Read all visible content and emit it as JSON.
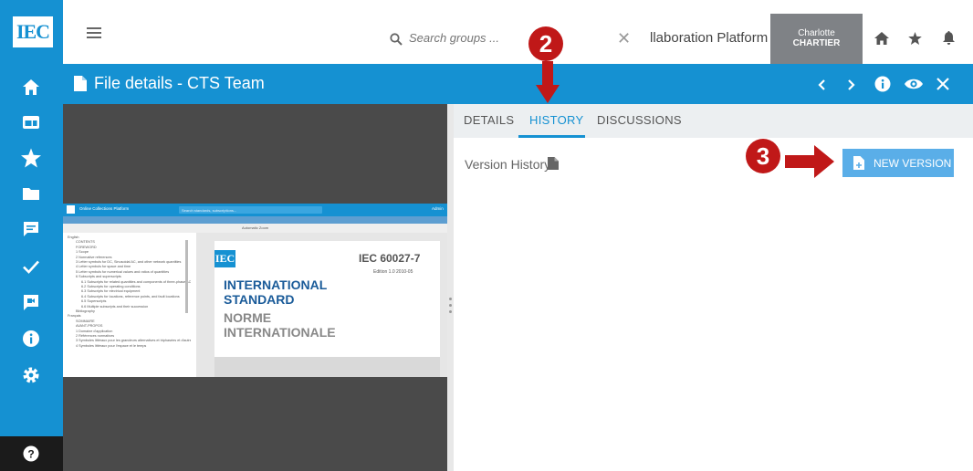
{
  "header": {
    "logo_text": "IEC",
    "search_placeholder": "Search groups ...",
    "platform_title": "llaboration Platform",
    "user": {
      "first_name": "Charlotte",
      "last_name": "CHARTIER"
    },
    "icons": [
      "menu-icon",
      "search-icon",
      "close-icon",
      "home-icon",
      "star-icon",
      "bell-icon"
    ]
  },
  "sidebar": {
    "items": [
      "home-icon",
      "dashboard-icon",
      "star-icon",
      "folder-icon",
      "chat-icon",
      "check-icon",
      "video-chat-icon",
      "info-icon",
      "settings-icon",
      "help-icon"
    ]
  },
  "file_bar": {
    "title": "File details - CTS Team",
    "icons": [
      "chevron-left-icon",
      "chevron-right-icon",
      "info-icon",
      "eye-icon",
      "close-icon"
    ]
  },
  "tabs": [
    {
      "label": "DETAILS",
      "active": false
    },
    {
      "label": "HISTORY",
      "active": true
    },
    {
      "label": "DISCUSSIONS",
      "active": false
    }
  ],
  "history_panel": {
    "section_label": "Version History",
    "new_version_label": "NEW VERSION"
  },
  "annotations": {
    "step_2": "2",
    "step_3": "3"
  },
  "preview": {
    "app_title": "Online Collections Platform",
    "search_placeholder": "Search standards, subscriptions...",
    "admin_label": "Admin",
    "toc_lines": [
      "English",
      "CONTENTS",
      "FOREWORD",
      "1 Scope",
      "2 Normative references",
      "3 Letter symbols for DC, Sinusoidal AC, and other network quantities",
      "4 Letter symbols for space and time",
      "5 Letter symbols for numerical values and ratios of quantities",
      "6 Subscripts and superscripts",
      "6.1 Subscripts for related quantities and components of three-phase AC systems",
      "6.2 Subscripts for operating conditions",
      "6.3 Subscripts for electrical equipment",
      "6.4 Subscripts for locations, reference points, and fault locations",
      "6.5 Superscripts",
      "6.6 Multiple subscripts and their succession",
      "Bibliography",
      "Français",
      "SOMMAIRE",
      "AVANT-PROPOS",
      "1 Domaine d'application",
      "2 Références normatives",
      "3 Symboles littéraux pour les grandeurs alternatives et triphasées et d'autres grandeurs de réseau",
      "4 Symboles littéraux pour l'espace et le temps"
    ],
    "doc": {
      "logo": "IEC",
      "standard_number": "IEC 60027-7",
      "edition": "Edition 1.0   2010-05",
      "title_en_1": "INTERNATIONAL",
      "title_en_2": "STANDARD",
      "title_fr_1": "NORME",
      "title_fr_2": "INTERNATIONALE",
      "zoom_label": "Automatic Zoom"
    }
  },
  "colors": {
    "brand_blue": "#1591d2",
    "button_blue": "#5aaee8",
    "annotation_red": "#c01818",
    "user_grey": "#7f8286"
  }
}
